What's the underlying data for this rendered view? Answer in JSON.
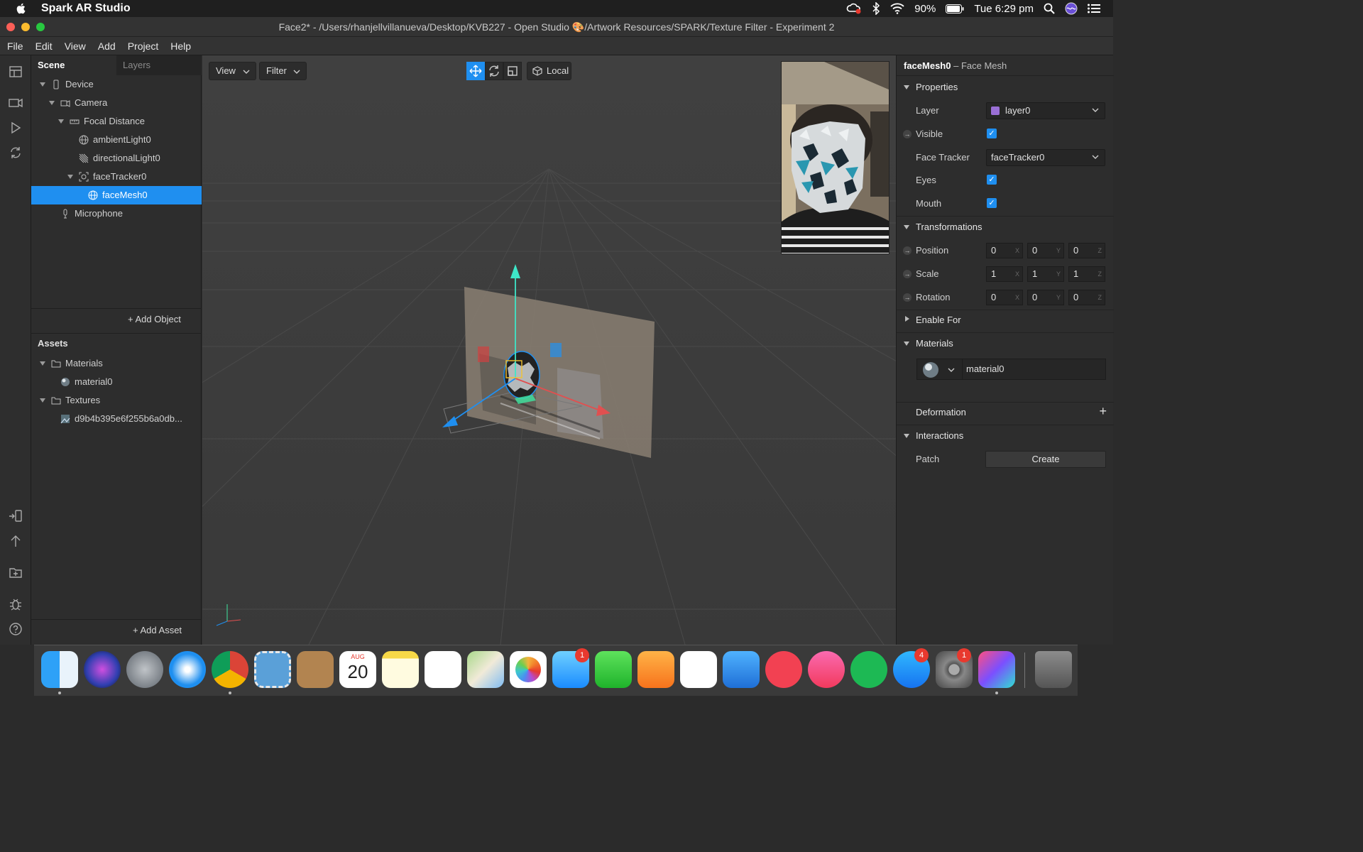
{
  "menubar": {
    "app_name": "Spark AR Studio",
    "battery": "90%",
    "clock": "Tue 6:29 pm"
  },
  "window": {
    "title": "Face2* - /Users/rhanjellvillanueva/Desktop/KVB227 - Open Studio 🎨/Artwork Resources/SPARK/Texture Filter - Experiment 2"
  },
  "app_menu": [
    "File",
    "Edit",
    "View",
    "Add",
    "Project",
    "Help"
  ],
  "left_panel": {
    "tab_scene": "Scene",
    "tab_layers": "Layers",
    "tree": [
      {
        "label": "Device",
        "icon": "device-icon"
      },
      {
        "label": "Camera",
        "icon": "camera-icon"
      },
      {
        "label": "Focal Distance",
        "icon": "focal-distance-icon"
      },
      {
        "label": "ambientLight0",
        "icon": "globe-icon"
      },
      {
        "label": "directionalLight0",
        "icon": "directional-light-icon"
      },
      {
        "label": "faceTracker0",
        "icon": "face-tracker-icon"
      },
      {
        "label": "faceMesh0",
        "icon": "globe-icon"
      },
      {
        "label": "Microphone",
        "icon": "microphone-icon"
      }
    ],
    "add_object": "Add Object",
    "assets_title": "Assets",
    "assets": [
      {
        "label": "Materials",
        "icon": "folder-icon"
      },
      {
        "label": "material0",
        "icon": "material-icon"
      },
      {
        "label": "Textures",
        "icon": "folder-icon"
      },
      {
        "label": "d9b4b395e6f255b6a0db...",
        "icon": "texture-icon"
      }
    ],
    "add_asset": "Add Asset"
  },
  "viewport": {
    "view_btn": "View",
    "filter_btn": "Filter",
    "local_btn": "Local"
  },
  "inspector": {
    "object_name": "faceMesh0",
    "object_type": " – Face Mesh",
    "properties": "Properties",
    "layer_label": "Layer",
    "layer_value": "layer0",
    "visible_label": "Visible",
    "face_tracker_label": "Face Tracker",
    "face_tracker_value": "faceTracker0",
    "eyes_label": "Eyes",
    "mouth_label": "Mouth",
    "transformations": "Transformations",
    "position_label": "Position",
    "scale_label": "Scale",
    "rotation_label": "Rotation",
    "position": [
      "0",
      "0",
      "0"
    ],
    "scale": [
      "1",
      "1",
      "1"
    ],
    "rotation": [
      "0",
      "0",
      "0"
    ],
    "axes": [
      "X",
      "Y",
      "Z"
    ],
    "enable_for": "Enable For",
    "materials": "Materials",
    "material_value": "material0",
    "deformation": "Deformation",
    "interactions": "Interactions",
    "patch_label": "Patch",
    "create_btn": "Create"
  },
  "dock": {
    "calendar_month": "AUG",
    "calendar_day": "20",
    "badges": {
      "messages": "1",
      "appstore": "4",
      "prefs": "1"
    }
  }
}
